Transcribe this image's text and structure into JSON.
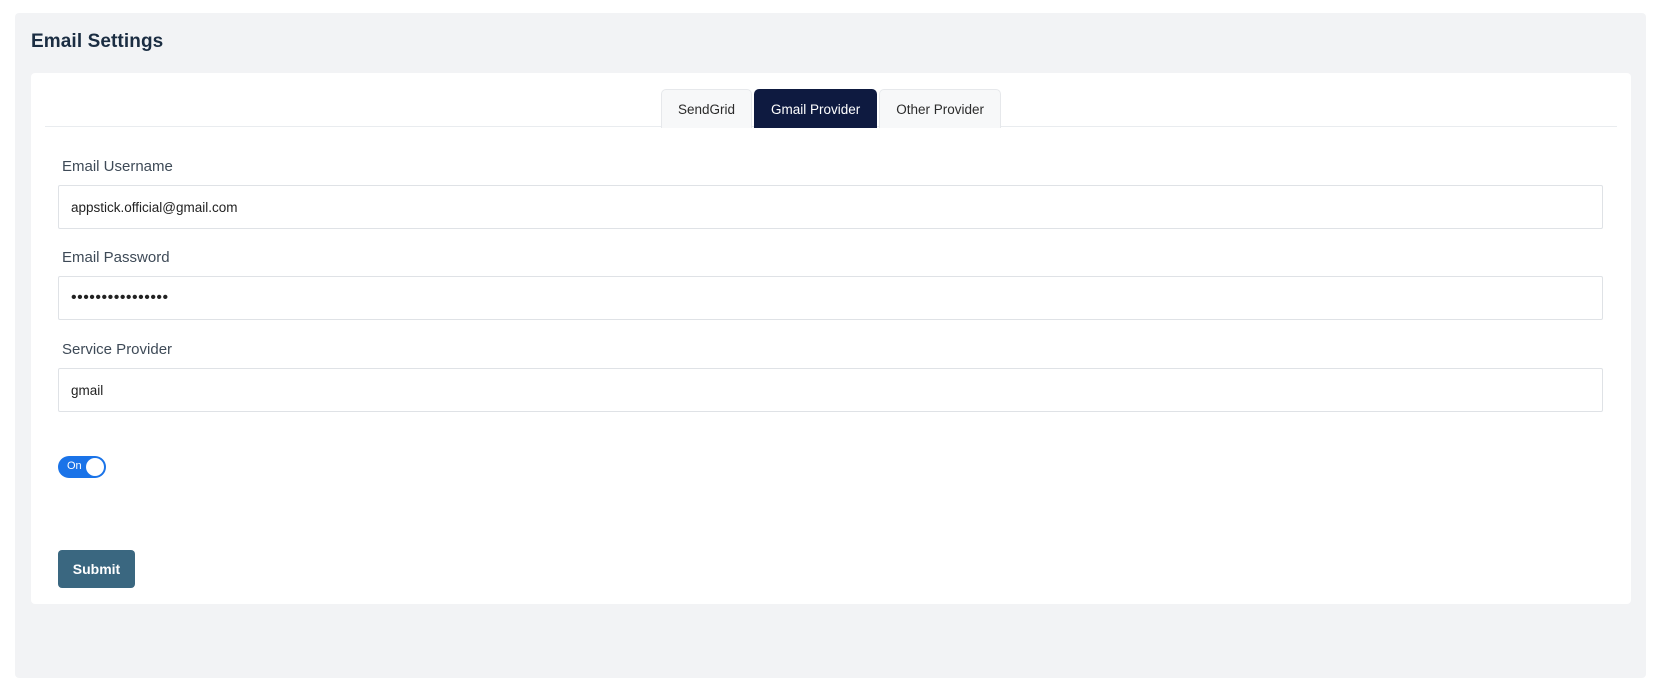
{
  "page": {
    "title": "Email Settings"
  },
  "tabs": [
    {
      "label": "SendGrid",
      "active": false
    },
    {
      "label": "Gmail Provider",
      "active": true
    },
    {
      "label": "Other Provider",
      "active": false
    }
  ],
  "form": {
    "username": {
      "label": "Email Username",
      "value": "appstick.official@gmail.com"
    },
    "password": {
      "label": "Email Password",
      "value": "••••••••••••••••"
    },
    "service": {
      "label": "Service Provider",
      "value": "gmail"
    },
    "toggle": {
      "label": "On",
      "state": true
    },
    "submit_label": "Submit"
  },
  "colors": {
    "active_tab": "#0e1a40",
    "toggle_on": "#1a73e8",
    "submit": "#3a6780"
  }
}
